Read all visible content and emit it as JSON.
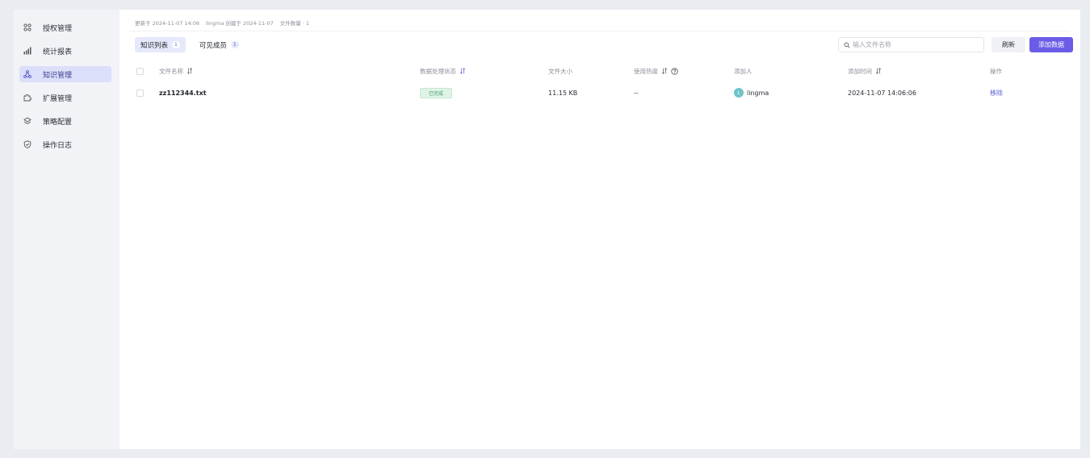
{
  "sidebar": {
    "items": [
      {
        "label": "授权管理",
        "icon": "grid-icon",
        "active": false
      },
      {
        "label": "统计报表",
        "icon": "bar-chart-icon",
        "active": false
      },
      {
        "label": "知识管理",
        "icon": "network-icon",
        "active": true
      },
      {
        "label": "扩展管理",
        "icon": "puzzle-icon",
        "active": false
      },
      {
        "label": "策略配置",
        "icon": "layers-icon",
        "active": false
      },
      {
        "label": "操作日志",
        "icon": "shield-icon",
        "active": false
      }
    ]
  },
  "meta": {
    "updated": "更新于 2024-11-07 14:06",
    "created": "lingma 创建于 2024-11-07",
    "file_count": "文件数量 · 1"
  },
  "tabs": [
    {
      "label": "知识列表",
      "count": "1",
      "active": true
    },
    {
      "label": "可见成员",
      "count": "1",
      "active": false
    }
  ],
  "toolbar": {
    "search_placeholder": "输入文件名称",
    "refresh_label": "刷新",
    "add_label": "添加数据"
  },
  "table": {
    "headers": {
      "name": "文件名称",
      "status": "数据处理状态",
      "size": "文件大小",
      "heat": "使用热度",
      "adder": "添加人",
      "time": "添加时间",
      "action": "操作"
    },
    "rows": [
      {
        "name": "zz112344.txt",
        "status": "已完成",
        "size": "11.15 KB",
        "heat": "--",
        "adder_initial": "L",
        "adder": "lingma",
        "time": "2024-11-07 14:06:06",
        "action": "移除"
      }
    ]
  },
  "colors": {
    "accent": "#6b5ce7",
    "link": "#5b61d6",
    "status_success_bg": "#dff3e6",
    "status_success_text": "#3c9b5f",
    "avatar": "#6fc3c8"
  }
}
